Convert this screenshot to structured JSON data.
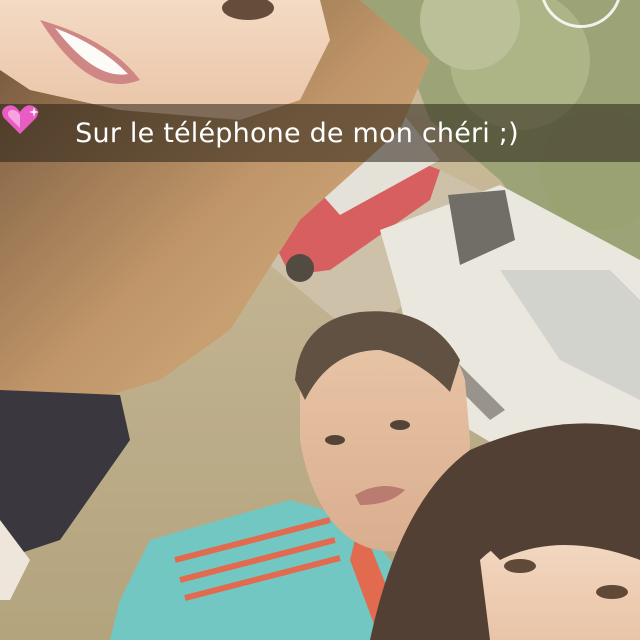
{
  "snap": {
    "caption": "Sur le téléphone de mon chéri  ;)",
    "caption_emoji": "sparkling-heart-icon"
  },
  "colors": {
    "caption_bar": "#28201680",
    "caption_text": "#ffffff",
    "heart": "#e85cc4"
  }
}
